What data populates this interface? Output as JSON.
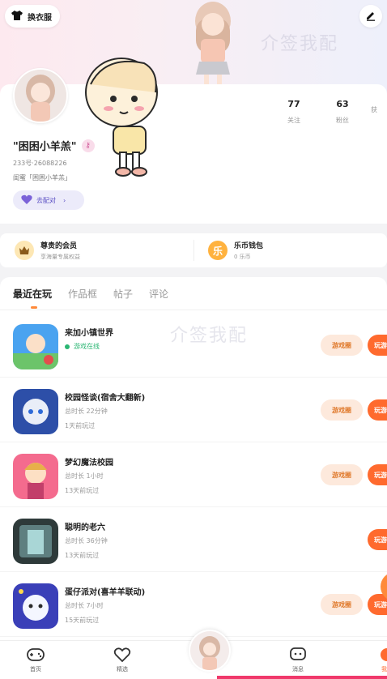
{
  "header": {
    "skin_button_label": "换衣服",
    "watermark": "介签我配"
  },
  "profile": {
    "nickname": "\"困困小羊羔\"",
    "uid": "233号·26088226",
    "bestie": "闺蜜「困困小羊羔」",
    "match_button_label": "去配对",
    "stats": [
      {
        "value": "77",
        "label": "关注"
      },
      {
        "value": "63",
        "label": "粉丝"
      },
      {
        "value": "",
        "label": "获"
      }
    ]
  },
  "wallet": {
    "items": [
      {
        "title": "尊贵的会员",
        "subtitle": "享海量专属权益",
        "icon": "crown-icon"
      },
      {
        "title": "乐币钱包",
        "subtitle": "0 乐币",
        "icon": "coin-icon",
        "icon_text": "乐"
      }
    ]
  },
  "tabs": [
    "最近在玩",
    "作品框",
    "帖子",
    "评论"
  ],
  "games": [
    {
      "name": "来加小镇世界",
      "line2": "游戏在线",
      "line3": "",
      "online": true,
      "circle_label": "游戏圈",
      "play_label": "玩游戏",
      "has_circle": true
    },
    {
      "name": "校园怪谈(宿舍大翻新)",
      "line2": "总时长 22分钟",
      "line3": "1天前玩过",
      "online": false,
      "circle_label": "游戏圈",
      "play_label": "玩游戏",
      "has_circle": true
    },
    {
      "name": "梦幻魔法校园",
      "line2": "总时长 1小时",
      "line3": "13天前玩过",
      "online": false,
      "circle_label": "游戏圈",
      "play_label": "玩游戏",
      "has_circle": true
    },
    {
      "name": "聪明的老六",
      "line2": "总时长 36分钟",
      "line3": "13天前玩过",
      "online": false,
      "circle_label": "",
      "play_label": "玩游戏",
      "has_circle": false
    },
    {
      "name": "蛋仔派对(喜羊羊联动)",
      "line2": "总时长 7小时",
      "line3": "15天前玩过",
      "online": false,
      "circle_label": "游戏圈",
      "play_label": "玩游戏",
      "has_circle": true
    }
  ],
  "bottom_nav": [
    {
      "label": "首页",
      "icon": "gamepad-icon"
    },
    {
      "label": "精选",
      "icon": "heart-chat-icon"
    },
    {
      "label": "",
      "icon": "avatar-icon"
    },
    {
      "label": "消息",
      "icon": "message-icon"
    },
    {
      "label": "我的",
      "icon": "me-icon"
    }
  ],
  "colors": {
    "accent": "#ff6a2e",
    "accent_soft": "#fde9dc",
    "online": "#2bb673",
    "match_bg": "#ecebfa"
  }
}
